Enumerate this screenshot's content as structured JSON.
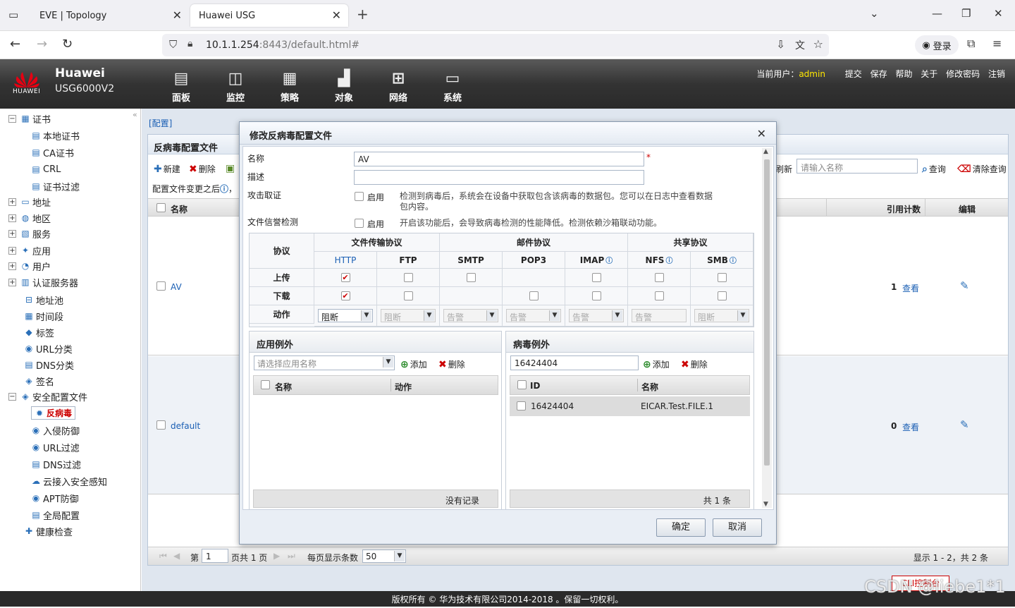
{
  "browser": {
    "tabs": [
      {
        "title": "EVE | Topology"
      },
      {
        "title": "Huawei USG"
      }
    ],
    "url_host": "10.1.1.254",
    "url_rest": ":8443/default.html#",
    "login_label": "登录"
  },
  "header": {
    "brand": "Huawei",
    "logo_text": "HUAWEI",
    "model": "USG6000V2",
    "menus": [
      {
        "label": "面板",
        "icon": "dashboard-icon"
      },
      {
        "label": "监控",
        "icon": "monitor-icon"
      },
      {
        "label": "策略",
        "icon": "policy-icon"
      },
      {
        "label": "对象",
        "icon": "object-icon"
      },
      {
        "label": "网络",
        "icon": "network-icon"
      },
      {
        "label": "系统",
        "icon": "system-icon"
      }
    ],
    "current_user_label": "当前用户：",
    "current_user": "admin",
    "links": [
      "提交",
      "保存",
      "帮助",
      "关于",
      "修改密码",
      "注销"
    ]
  },
  "tree": {
    "items": [
      {
        "label": "证书",
        "level": 0,
        "expand": "−"
      },
      {
        "label": "本地证书",
        "level": 1
      },
      {
        "label": "CA证书",
        "level": 1
      },
      {
        "label": "CRL",
        "level": 1
      },
      {
        "label": "证书过滤",
        "level": 1
      },
      {
        "label": "地址",
        "level": 0,
        "expand": "+"
      },
      {
        "label": "地区",
        "level": 0,
        "expand": "+"
      },
      {
        "label": "服务",
        "level": 0,
        "expand": "+"
      },
      {
        "label": "应用",
        "level": 0,
        "expand": "+"
      },
      {
        "label": "用户",
        "level": 0,
        "expand": "+"
      },
      {
        "label": "认证服务器",
        "level": 0,
        "expand": "+"
      },
      {
        "label": "地址池",
        "level": 0
      },
      {
        "label": "时间段",
        "level": 0
      },
      {
        "label": "标签",
        "level": 0
      },
      {
        "label": "URL分类",
        "level": 0
      },
      {
        "label": "DNS分类",
        "level": 0
      },
      {
        "label": "签名",
        "level": 0
      },
      {
        "label": "安全配置文件",
        "level": 0,
        "expand": "−"
      },
      {
        "label": "反病毒",
        "level": 1,
        "selected": true
      },
      {
        "label": "入侵防御",
        "level": 1
      },
      {
        "label": "URL过滤",
        "level": 1
      },
      {
        "label": "DNS过滤",
        "level": 1
      },
      {
        "label": "云接入安全感知",
        "level": 1
      },
      {
        "label": "APT防御",
        "level": 1
      },
      {
        "label": "全局配置",
        "level": 1
      },
      {
        "label": "健康检查",
        "level": 0
      }
    ]
  },
  "main": {
    "breadcrumb": "[配置]",
    "panel_title": "反病毒配置文件",
    "new_label": "新建",
    "delete_label": "删除",
    "notice": "配置文件变更之后",
    "notice_tail": "，",
    "refresh_label": "刷新",
    "search_placeholder": "请输入名称",
    "query_label": "查询",
    "clear_query_label": "清除查询",
    "columns": {
      "name": "名称",
      "ref_count": "引用计数",
      "edit": "编辑"
    },
    "rows": [
      {
        "name": "AV",
        "ref_count": "1",
        "view": "查看"
      },
      {
        "name": "default",
        "ref_count": "0",
        "view": "查看"
      }
    ],
    "pager": {
      "page_prefix": "第",
      "page": "1",
      "page_suffix": "页共 1 页",
      "per_page_label": "每页显示条数",
      "per_page": "50",
      "summary": "显示 1 - 2，共 2 条"
    },
    "cli_label": "CLI控制台"
  },
  "modal": {
    "title": "修改反病毒配置文件",
    "name_label": "名称",
    "name_value": "AV",
    "required_mark": "*",
    "desc_label": "描述",
    "desc_value": "",
    "evidence_label": "攻击取证",
    "evidence_enable": "启用",
    "evidence_desc": "检测到病毒后，系统会在设备中获取包含该病毒的数据包。您可以在日志中查看数据包内容。",
    "reputation_label": "文件信誉检测",
    "reputation_enable": "启用",
    "reputation_desc": "开启该功能后，会导致病毒检测的性能降低。检测依赖沙箱联动功能。",
    "grid": {
      "protocol_label": "协议",
      "group_file": "文件传输协议",
      "group_mail": "邮件协议",
      "group_share": "共享协议",
      "protocols": [
        "HTTP",
        "FTP",
        "SMTP",
        "POP3",
        "IMAP",
        "NFS",
        "SMB"
      ],
      "upload_label": "上传",
      "download_label": "下载",
      "action_label": "动作",
      "upload": [
        true,
        false,
        false,
        null,
        false,
        false,
        false
      ],
      "download": [
        true,
        false,
        null,
        false,
        false,
        false,
        false
      ],
      "actions": [
        "阻断",
        "阻断",
        "告警",
        "告警",
        "告警",
        "告警",
        "阻断"
      ]
    },
    "app_exception": {
      "title": "应用例外",
      "select_placeholder": "请选择应用名称",
      "add_label": "添加",
      "delete_label": "删除",
      "col_name": "名称",
      "col_action": "动作",
      "empty": "没有记录"
    },
    "virus_exception": {
      "title": "病毒例外",
      "input_value": "16424404",
      "add_label": "添加",
      "delete_label": "删除",
      "col_id": "ID",
      "col_name": "名称",
      "rows": [
        {
          "id": "16424404",
          "name": "EICAR.Test.FILE.1"
        }
      ],
      "total": "共 1 条"
    },
    "ok_label": "确定",
    "cancel_label": "取消"
  },
  "footer": {
    "copyright": "版权所有 © 华为技术有限公司2014-2018 。保留一切权利。"
  },
  "watermark": "CSDN @liebe1*1",
  "colors": {
    "accent_red": "#cc0000",
    "link_blue": "#1a5fb4",
    "header_dark": "#333333",
    "user_yellow": "#ffe600"
  }
}
